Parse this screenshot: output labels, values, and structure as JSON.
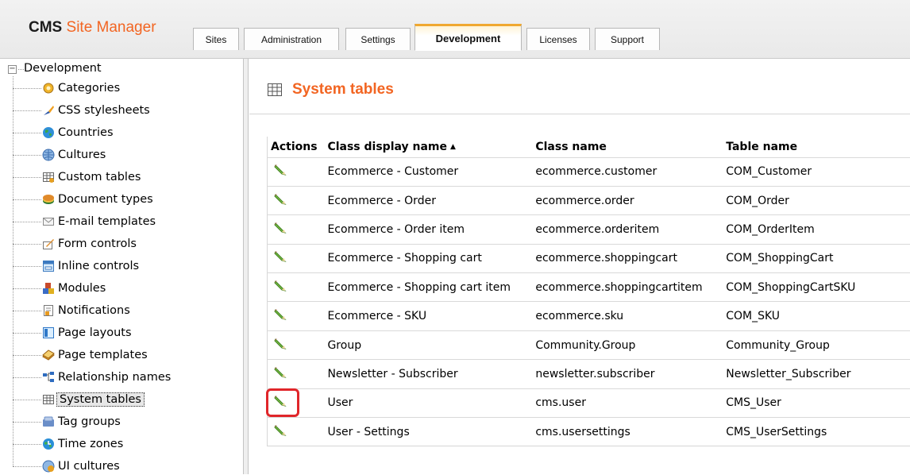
{
  "header": {
    "brand": "CMS",
    "product": "Site Manager",
    "tabs": [
      {
        "label": "Sites"
      },
      {
        "label": "Administration"
      },
      {
        "label": "Settings"
      },
      {
        "label": "Development"
      },
      {
        "label": "Licenses"
      },
      {
        "label": "Support"
      }
    ],
    "active_tab": "Development",
    "accent_color": "#f26522"
  },
  "tree": {
    "root": {
      "label": "Development",
      "toggle": "−"
    },
    "items": [
      {
        "label": "Categories",
        "icon": "categories-icon"
      },
      {
        "label": "CSS stylesheets",
        "icon": "css-stylesheets-icon"
      },
      {
        "label": "Countries",
        "icon": "countries-icon"
      },
      {
        "label": "Cultures",
        "icon": "cultures-icon"
      },
      {
        "label": "Custom tables",
        "icon": "custom-tables-icon"
      },
      {
        "label": "Document types",
        "icon": "document-types-icon"
      },
      {
        "label": "E-mail templates",
        "icon": "email-templates-icon"
      },
      {
        "label": "Form controls",
        "icon": "form-controls-icon"
      },
      {
        "label": "Inline controls",
        "icon": "inline-controls-icon"
      },
      {
        "label": "Modules",
        "icon": "modules-icon"
      },
      {
        "label": "Notifications",
        "icon": "notifications-icon"
      },
      {
        "label": "Page layouts",
        "icon": "page-layouts-icon"
      },
      {
        "label": "Page templates",
        "icon": "page-templates-icon"
      },
      {
        "label": "Relationship names",
        "icon": "relationship-names-icon"
      },
      {
        "label": "System tables",
        "icon": "system-tables-icon",
        "selected": true
      },
      {
        "label": "Tag groups",
        "icon": "tag-groups-icon"
      },
      {
        "label": "Time zones",
        "icon": "time-zones-icon"
      },
      {
        "label": "UI cultures",
        "icon": "ui-cultures-icon"
      }
    ]
  },
  "main": {
    "title": "System tables",
    "title_icon": "table-icon",
    "grid": {
      "columns": [
        "Actions",
        "Class display name",
        "Class name",
        "Table name"
      ],
      "sorted_column": "Class display name",
      "sort_indicator": "▲",
      "rows": [
        {
          "display": "Ecommerce - Customer",
          "class": "ecommerce.customer",
          "table": "COM_Customer"
        },
        {
          "display": "Ecommerce - Order",
          "class": "ecommerce.order",
          "table": "COM_Order"
        },
        {
          "display": "Ecommerce - Order item",
          "class": "ecommerce.orderitem",
          "table": "COM_OrderItem"
        },
        {
          "display": "Ecommerce - Shopping cart",
          "class": "ecommerce.shoppingcart",
          "table": "COM_ShoppingCart"
        },
        {
          "display": "Ecommerce - Shopping cart item",
          "class": "ecommerce.shoppingcartitem",
          "table": "COM_ShoppingCartSKU"
        },
        {
          "display": "Ecommerce - SKU",
          "class": "ecommerce.sku",
          "table": "COM_SKU"
        },
        {
          "display": "Group",
          "class": "Community.Group",
          "table": "Community_Group"
        },
        {
          "display": "Newsletter - Subscriber",
          "class": "newsletter.subscriber",
          "table": "Newsletter_Subscriber"
        },
        {
          "display": "User",
          "class": "cms.user",
          "table": "CMS_User",
          "highlighted": true
        },
        {
          "display": "User - Settings",
          "class": "cms.usersettings",
          "table": "CMS_UserSettings"
        }
      ]
    },
    "highlight_color": "#e0262a"
  }
}
